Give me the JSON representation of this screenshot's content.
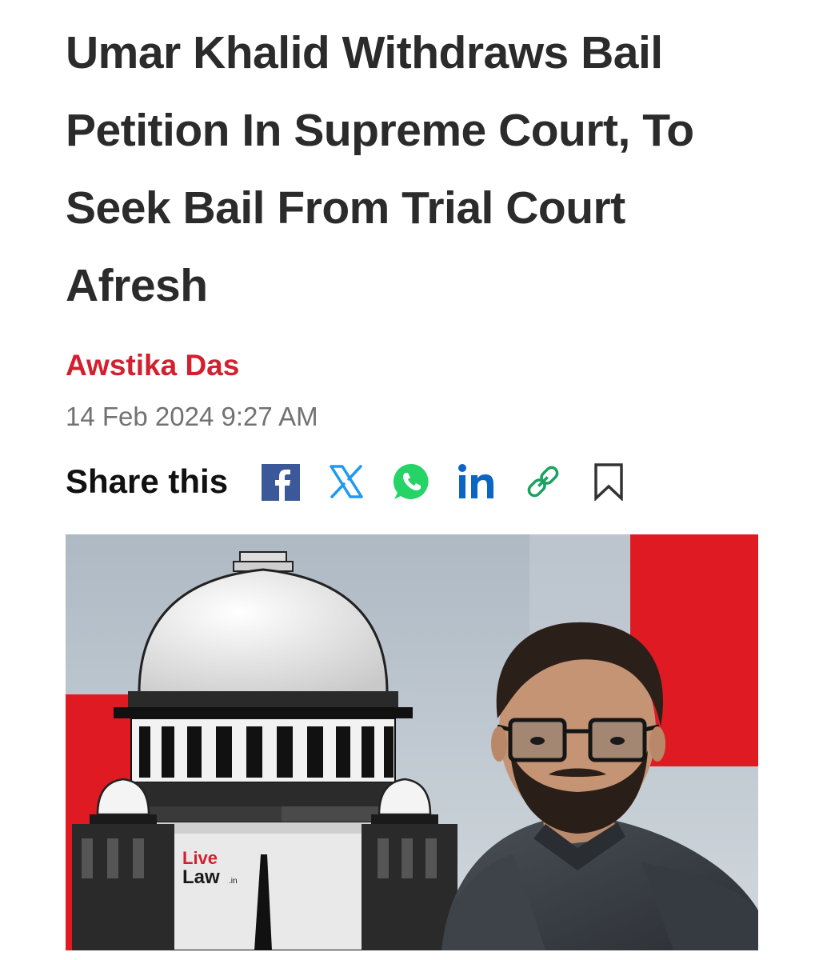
{
  "article": {
    "headline": "Umar Khalid Withdraws Bail Petition In Supreme Court, To Seek Bail From Trial Court Afresh",
    "author": "Awstika Das",
    "date": "14 Feb 2024 9:27 AM"
  },
  "share": {
    "label": "Share this",
    "buttons": [
      {
        "icon": "facebook-icon",
        "color": "#3b5998"
      },
      {
        "icon": "x-icon",
        "color": "#1d9bf0"
      },
      {
        "icon": "whatsapp-icon",
        "color": "#25d366"
      },
      {
        "icon": "linkedin-icon",
        "color": "#0a66c2"
      },
      {
        "icon": "link-icon",
        "color": "#1aa260"
      },
      {
        "icon": "bookmark-icon",
        "color": "#333333"
      }
    ]
  },
  "image": {
    "logo_line1": "Live",
    "logo_line2": "Law",
    "logo_suffix": ".in"
  },
  "colors": {
    "author": "#d41f2f",
    "headline": "#2b2b2b",
    "accent_red": "#e01a22"
  }
}
